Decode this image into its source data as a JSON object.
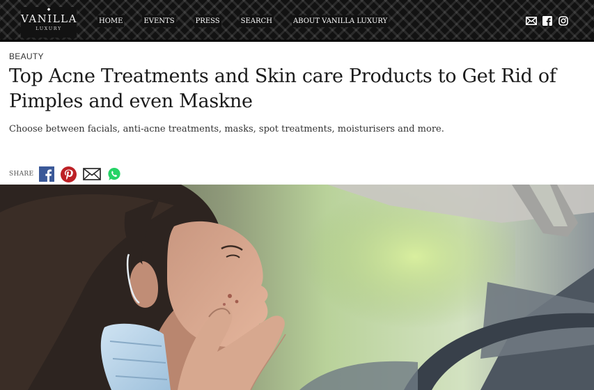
{
  "site": {
    "logo_main": "VANILLA",
    "logo_sub": "LUXURY"
  },
  "nav": {
    "items": [
      {
        "label": "HOME"
      },
      {
        "label": "EVENTS"
      },
      {
        "label": "PRESS"
      },
      {
        "label": "SEARCH"
      },
      {
        "label": "ABOUT VANILLA LUXURY"
      }
    ]
  },
  "header_social_icons": [
    "mail-icon",
    "facebook-icon",
    "instagram-icon"
  ],
  "article": {
    "category": "BEAUTY",
    "title": "Top Acne Treatments and Skin care Products to Get Rid of Pimples and even Maskne",
    "subtitle": "Choose between facials, anti-acne treatments, masks, spot treatments, moisturisers and more."
  },
  "share": {
    "label": "SHARE",
    "buttons": [
      "facebook-icon",
      "pinterest-icon",
      "email-icon",
      "whatsapp-icon"
    ]
  },
  "colors": {
    "header_bg": "#121212",
    "facebook": "#3b5998",
    "pinterest": "#bd2126",
    "whatsapp": "#25d366"
  }
}
